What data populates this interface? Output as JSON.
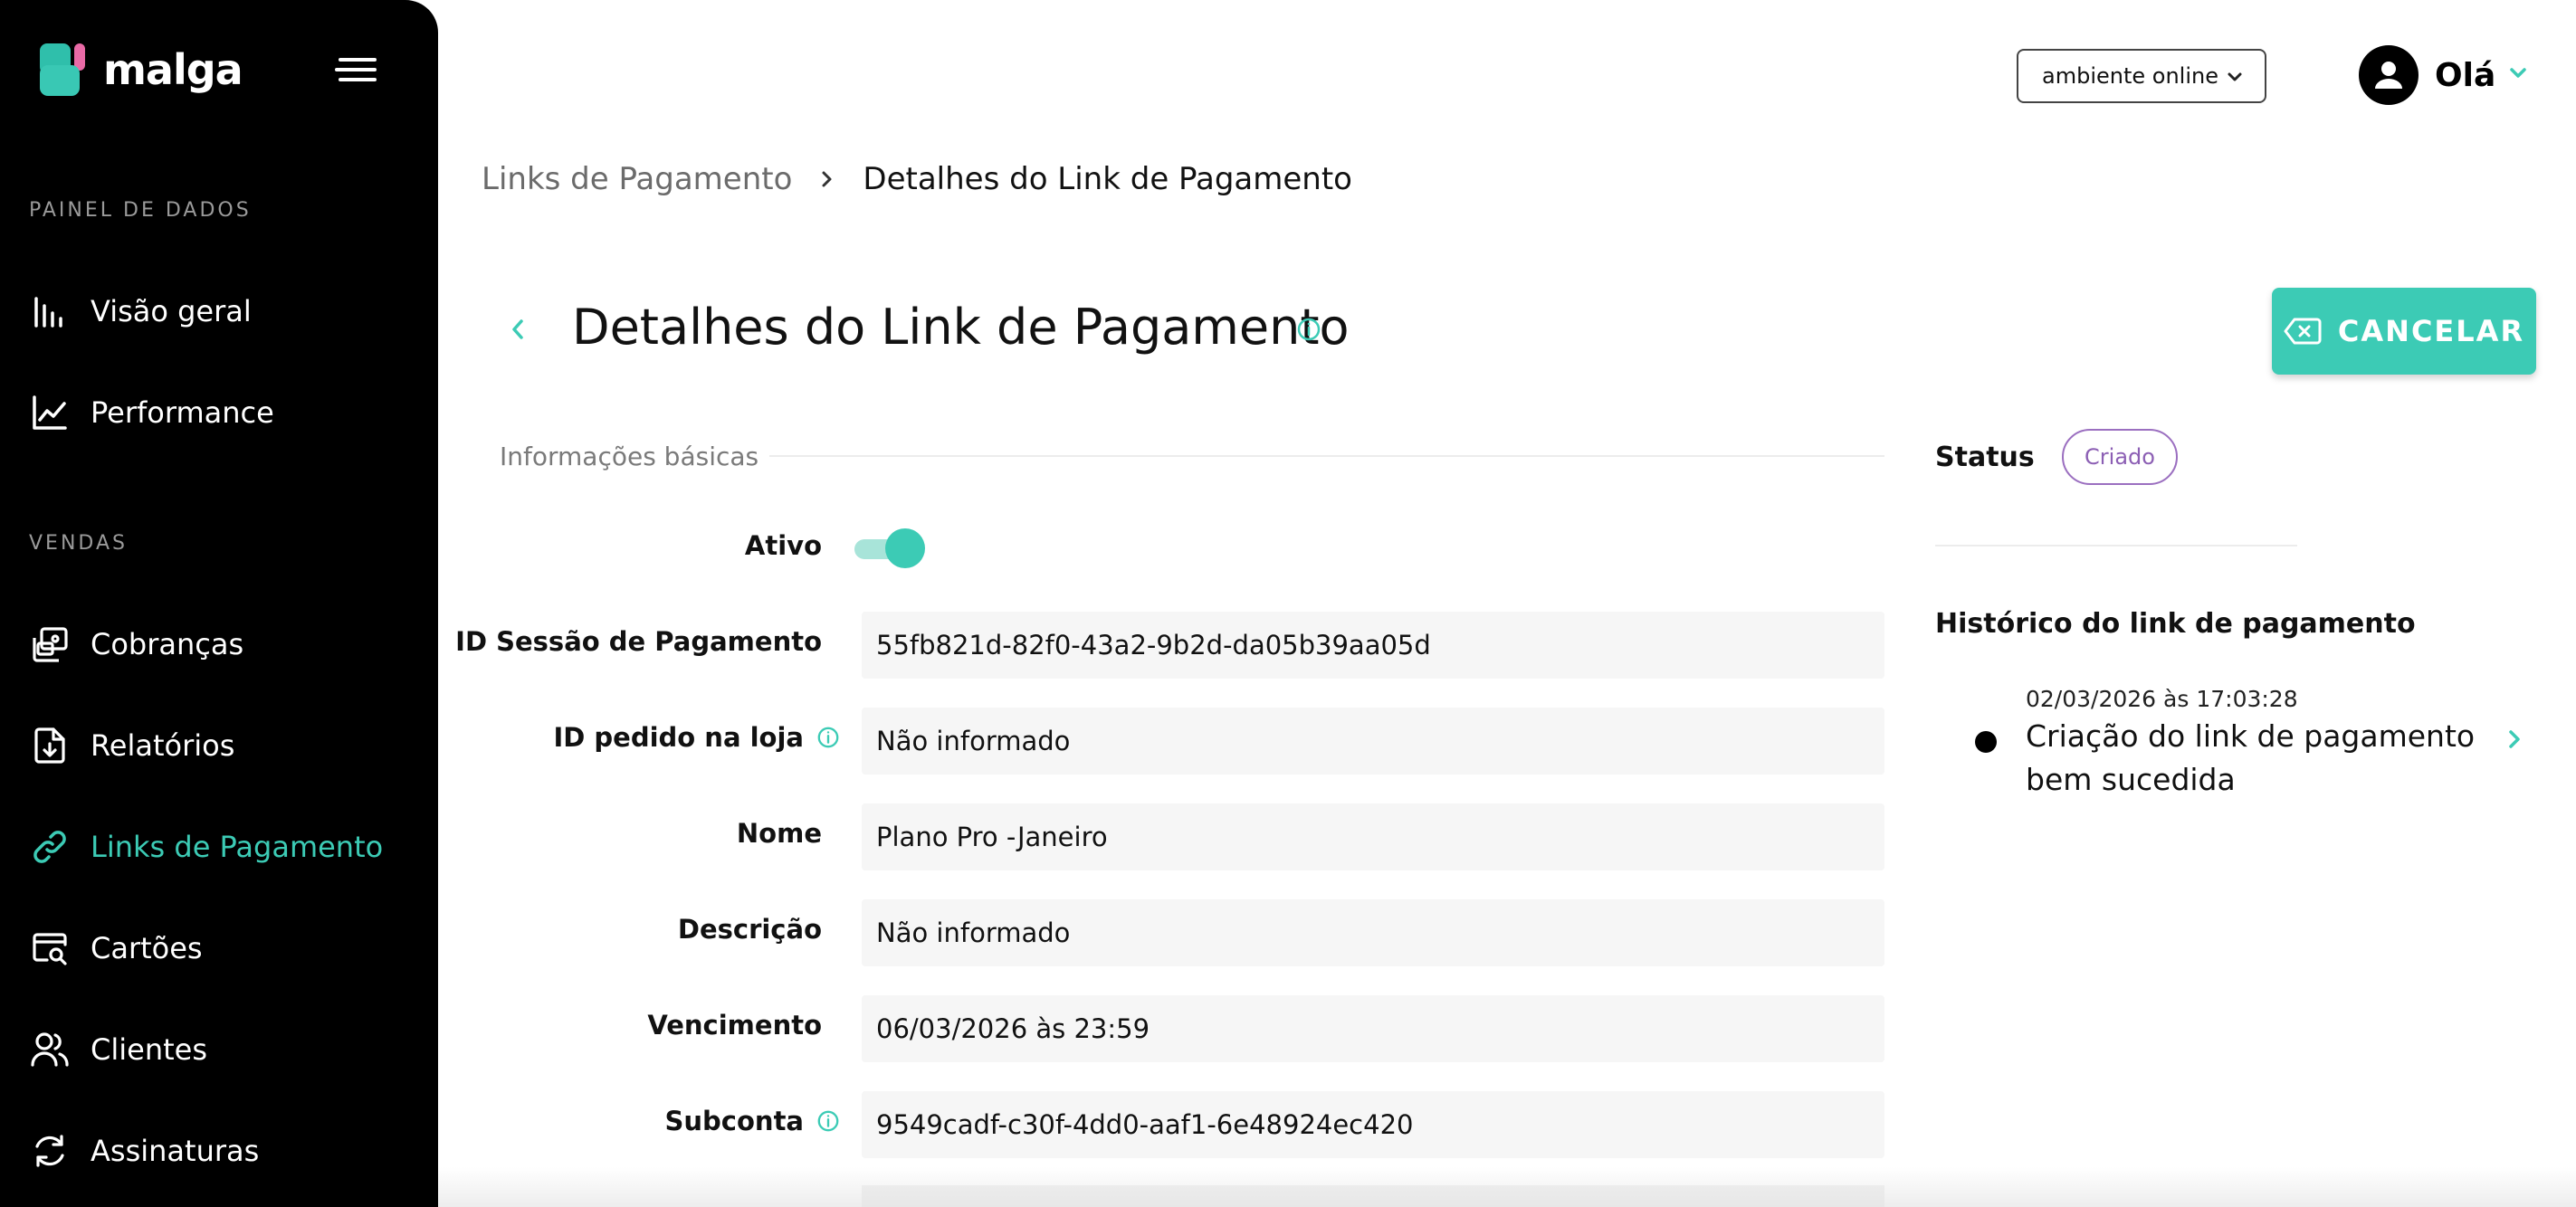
{
  "brand": {
    "name": "malga"
  },
  "sidebar": {
    "section_dashboard": "PAINEL DE DADOS",
    "section_sales": "VENDAS",
    "items": [
      {
        "label": "Visão geral",
        "icon": "bar-chart-icon"
      },
      {
        "label": "Performance",
        "icon": "line-chart-icon"
      },
      {
        "label": "Cobranças",
        "icon": "charges-icon"
      },
      {
        "label": "Relatórios",
        "icon": "report-download-icon"
      },
      {
        "label": "Links de Pagamento",
        "icon": "link-icon",
        "active": true
      },
      {
        "label": "Cartões",
        "icon": "card-search-icon"
      },
      {
        "label": "Clientes",
        "icon": "users-icon"
      },
      {
        "label": "Assinaturas",
        "icon": "refresh-icon"
      }
    ]
  },
  "header": {
    "environment": "ambiente online",
    "greeting": "Olá"
  },
  "breadcrumb": {
    "parent": "Links de Pagamento",
    "current": "Detalhes do Link de Pagamento"
  },
  "page": {
    "title": "Detalhes do Link de Pagamento",
    "cancel_label": "CANCELAR"
  },
  "basic_info": {
    "heading": "Informações básicas",
    "active_label": "Ativo",
    "active": true,
    "fields": [
      {
        "label": "ID Sessão de Pagamento",
        "value": "55fb821d-82f0-43a2-9b2d-da05b39aa05d"
      },
      {
        "label": "ID pedido na loja",
        "value": "Não informado",
        "info": true
      },
      {
        "label": "Nome",
        "value": "Plano Pro -Janeiro"
      },
      {
        "label": "Descrição",
        "value": "Não informado"
      },
      {
        "label": "Vencimento",
        "value": "06/03/2026 às 23:59"
      },
      {
        "label": "Subconta",
        "value": "9549cadf-c30f-4dd0-aaf1-6e48924ec420",
        "info": true
      }
    ]
  },
  "status": {
    "label": "Status",
    "value": "Criado",
    "color": "#8c5fb4"
  },
  "history": {
    "title": "Histórico do link de pagamento",
    "events": [
      {
        "date": "02/03/2026 às 17:03:28",
        "text": "Criação do link de pagamento bem sucedida"
      }
    ]
  },
  "colors": {
    "accent": "#3ccbb5",
    "sidebar_bg": "#000000",
    "status_purple": "#8c5fb4"
  }
}
